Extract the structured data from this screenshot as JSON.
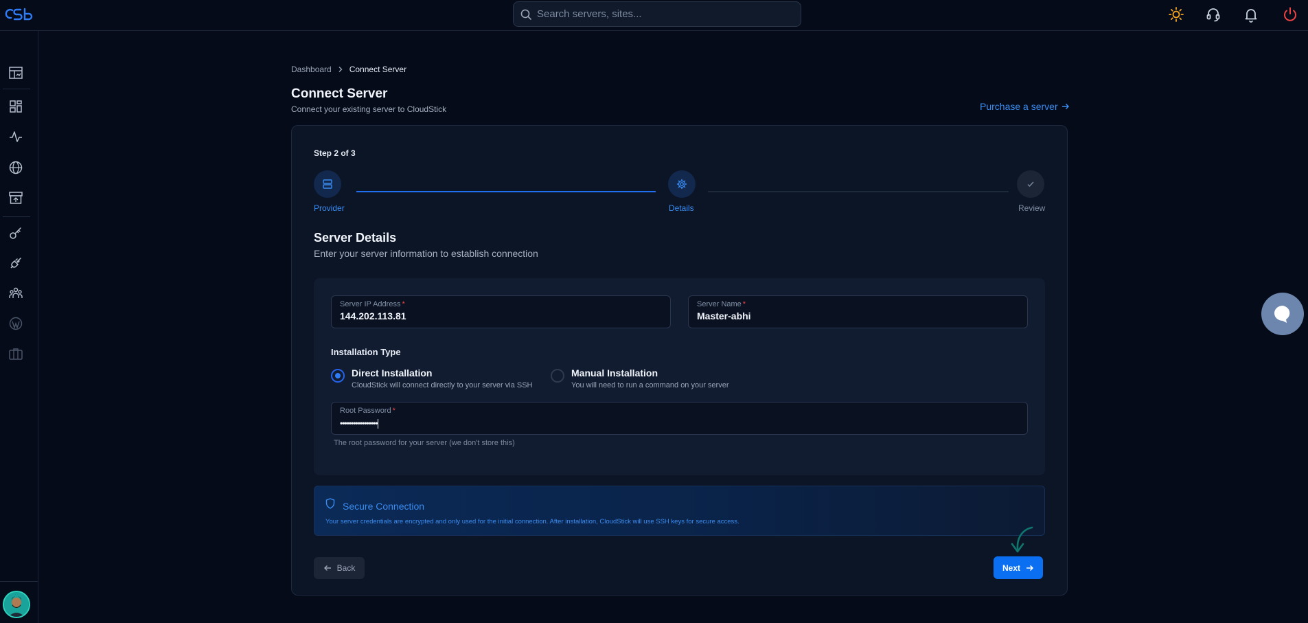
{
  "search": {
    "placeholder": "Search servers, sites..."
  },
  "header_icons": [
    "sun-icon",
    "headset-icon",
    "bell-icon",
    "power-icon"
  ],
  "sidebar": {
    "items": [
      "dashboard-icon",
      "grid-icon",
      "activity-icon",
      "globe-icon",
      "archive-icon",
      "key-icon",
      "plug-icon",
      "team-icon",
      "wordpress-icon",
      "briefcase-icon"
    ]
  },
  "breadcrumb": {
    "root": "Dashboard",
    "current": "Connect Server"
  },
  "page": {
    "title": "Connect Server",
    "subtitle": "Connect your existing server to CloudStick",
    "purchase_link": "Purchase a server"
  },
  "stepper": {
    "label": "Step 2 of 3",
    "steps": [
      "Provider",
      "Details",
      "Review"
    ],
    "current_step": 2
  },
  "details": {
    "title": "Server Details",
    "subtitle": "Enter your server information to establish connection",
    "ip_label": "Server IP Address",
    "ip_value": "144.202.113.81",
    "name_label": "Server Name",
    "name_value": "Master-abhi",
    "install_title": "Installation Type",
    "direct_title": "Direct Installation",
    "direct_desc": "CloudStick will connect directly to your server via SSH",
    "manual_title": "Manual Installation",
    "manual_desc": "You will need to run a command on your server",
    "selected_install": "Direct Installation",
    "pw_label": "Root Password",
    "pw_value": "•••••••••••••••••",
    "pw_hint": "The root password for your server (we don't store this)"
  },
  "secure": {
    "title": "Secure Connection",
    "text": "Your server credentials are encrypted and only used for the initial connection. After installation, CloudStick will use SSH keys for secure access."
  },
  "buttons": {
    "back": "Back",
    "next": "Next"
  },
  "colors": {
    "accent": "#0b6ff2",
    "background": "#050b18",
    "card": "#0c1526",
    "required": "#ef4444"
  }
}
